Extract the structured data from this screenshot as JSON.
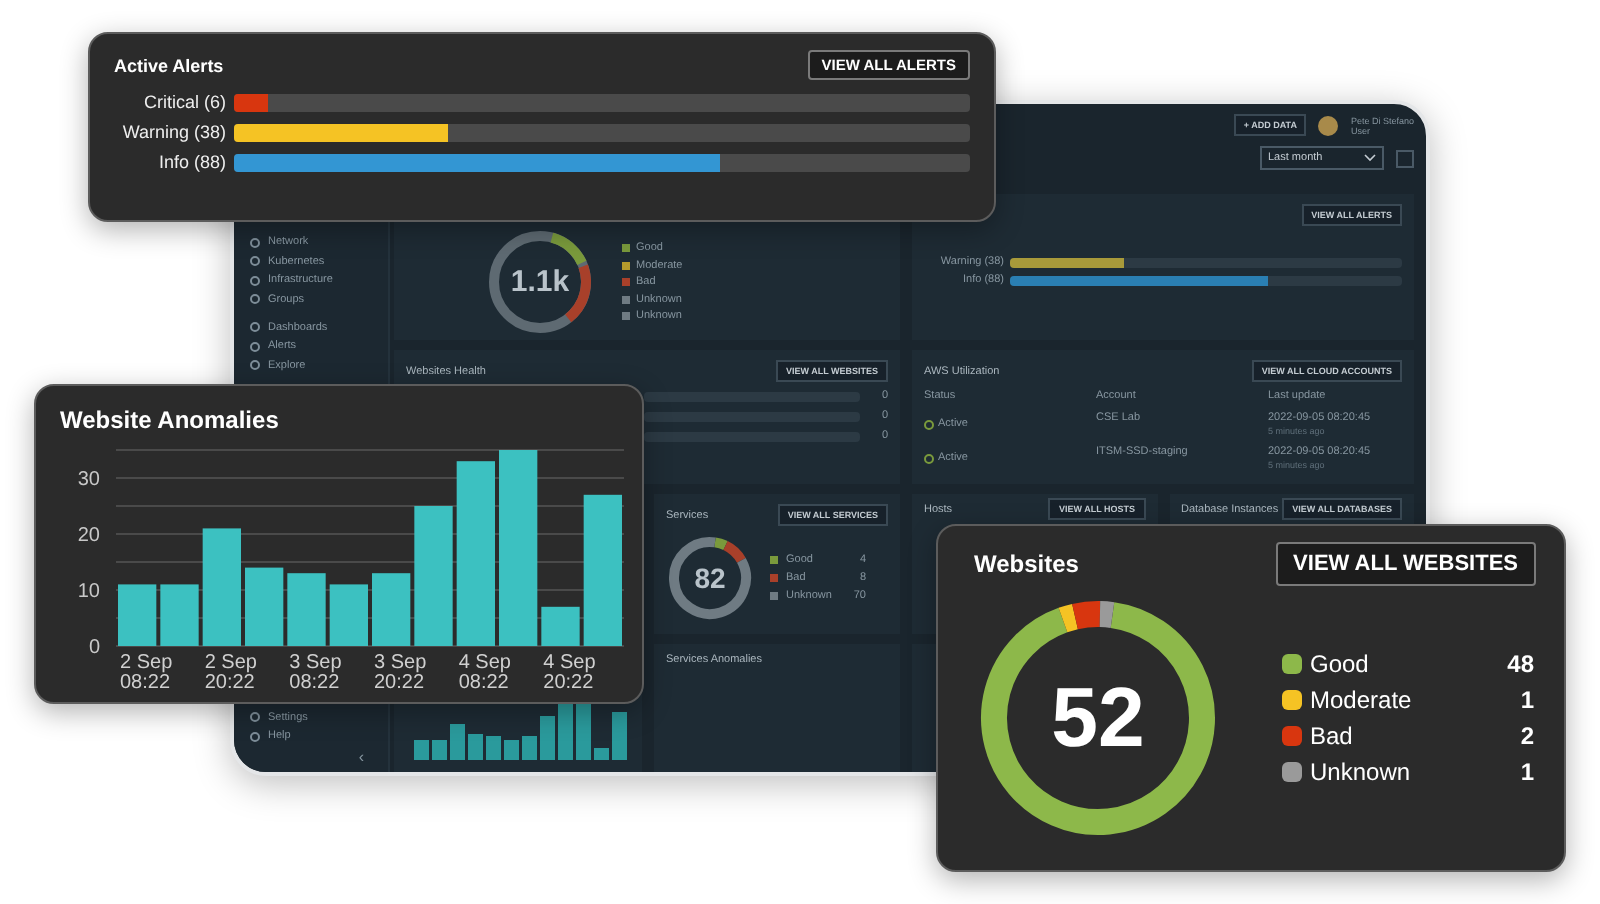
{
  "dashboard": {
    "sidebar": {
      "items": [
        {
          "label": "Network"
        },
        {
          "label": "Kubernetes"
        },
        {
          "label": "Infrastructure"
        },
        {
          "label": "Groups"
        }
      ],
      "items_2": [
        {
          "label": "Dashboards"
        },
        {
          "label": "Alerts"
        },
        {
          "label": "Explore"
        }
      ],
      "bottom_items": [
        {
          "label": "Settings"
        },
        {
          "label": "Help"
        }
      ],
      "collapse": "‹"
    },
    "header": {
      "add_button": "+ ADD DATA",
      "user_name": "Pete Di Stefano",
      "user_role": "User",
      "period": "Last month"
    },
    "overview": {
      "total": "1.1k",
      "legend": [
        {
          "label": "Good",
          "color": "#7a9a3c"
        },
        {
          "label": "Moderate",
          "color": "#b59a2c"
        },
        {
          "label": "Bad",
          "color": "#a8402a"
        },
        {
          "label": "Unknown",
          "color": "#6f7b83"
        },
        {
          "label": "Unknown",
          "color": "#6f7b83"
        }
      ]
    },
    "alerts_panel": {
      "button": "VIEW ALL ALERTS",
      "rows": [
        {
          "label": "Warning (38)",
          "level": 0.29,
          "color": "#a89a3a"
        },
        {
          "label": "Info (88)",
          "level": 0.66,
          "color": "#2a7fb3"
        }
      ]
    },
    "websites_health": {
      "title": "Websites Health",
      "button": "VIEW ALL WEBSITES",
      "rows": [
        {
          "value": "0",
          "level": 0
        },
        {
          "value": "0",
          "level": 0
        },
        {
          "value": "0",
          "level": 0
        }
      ]
    },
    "aws": {
      "title": "AWS Utilization",
      "button": "VIEW ALL CLOUD ACCOUNTS",
      "columns": [
        "Status",
        "Account",
        "Last update"
      ],
      "rows": [
        {
          "status": "Active",
          "account": "CSE Lab",
          "updated": "2022-09-05 08:20:45",
          "ago": "5 minutes ago"
        },
        {
          "status": "Active",
          "account": "ITSM-SSD-staging",
          "updated": "2022-09-05 08:20:45",
          "ago": "5 minutes ago"
        }
      ]
    },
    "services": {
      "title": "Services",
      "button": "VIEW ALL SERVICES",
      "total": "82",
      "legend": [
        {
          "label": "Good",
          "value": "4",
          "color": "#7a9a3c"
        },
        {
          "label": "Bad",
          "value": "8",
          "color": "#a8402a"
        },
        {
          "label": "Unknown",
          "value": "70",
          "color": "#6f7b83"
        }
      ]
    },
    "hosts": {
      "title": "Hosts",
      "button": "VIEW ALL HOSTS"
    },
    "databases": {
      "title": "Database Instances",
      "button": "VIEW ALL DATABASES"
    },
    "services_anomalies": {
      "title": "Services Anomalies"
    }
  },
  "active_alerts": {
    "title": "Active Alerts",
    "button": "VIEW ALL ALERTS",
    "rows": [
      {
        "label": "Critical (6)",
        "level": 0.045,
        "color": "#d8360f"
      },
      {
        "label": "Warning (38)",
        "level": 0.29,
        "color": "#f5c324"
      },
      {
        "label": "Info (88)",
        "level": 0.66,
        "color": "#3396d3"
      }
    ]
  },
  "website_anomalies": {
    "title": "Website Anomalies",
    "chart_data": {
      "type": "bar",
      "categories": [
        "2 Sep 08:22",
        null,
        "2 Sep 20:22",
        null,
        "3 Sep 08:22",
        null,
        "3 Sep 20:22",
        null,
        "4 Sep 08:22",
        null,
        "4 Sep 20:22",
        null
      ],
      "series": [
        {
          "color": "#3cc1c1",
          "values": [
            11,
            11,
            21,
            14,
            13,
            11,
            13,
            25,
            33,
            35,
            7,
            27
          ]
        }
      ],
      "ylim": [
        0,
        35
      ],
      "yticks": [
        0,
        10,
        20,
        30
      ],
      "grid": true
    }
  },
  "websites": {
    "title": "Websites",
    "button": "VIEW ALL WEBSITES",
    "total": "52",
    "legend": [
      {
        "label": "Good",
        "value": "48",
        "color": "#8db84a"
      },
      {
        "label": "Moderate",
        "value": "1",
        "color": "#f5c324"
      },
      {
        "label": "Bad",
        "value": "2",
        "color": "#d8360f"
      },
      {
        "label": "Unknown",
        "value": "1",
        "color": "#9a9a9a"
      }
    ]
  }
}
